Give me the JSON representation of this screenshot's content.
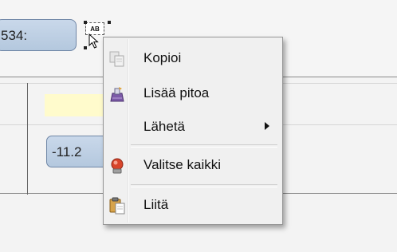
{
  "fields": {
    "top_value": "534:",
    "middle_value": "-11.2",
    "ab_chip_label": "AB"
  },
  "context_menu": {
    "items": [
      {
        "label": "Kopioi",
        "icon": "copy-icon"
      },
      {
        "label": "Lisää pitoa",
        "icon": "add-hold-icon"
      },
      {
        "label": "Lähetä",
        "icon": "none",
        "submenu": true
      },
      {
        "label": "Valitse kaikki",
        "icon": "select-all-icon"
      },
      {
        "label": "Liitä",
        "icon": "paste-icon"
      }
    ]
  },
  "colors": {
    "value_box_fill": "#c2d3e7",
    "value_box_border": "#6f86a6",
    "yellow_field": "#fffbcc",
    "menu_background": "#f0f0f0"
  }
}
